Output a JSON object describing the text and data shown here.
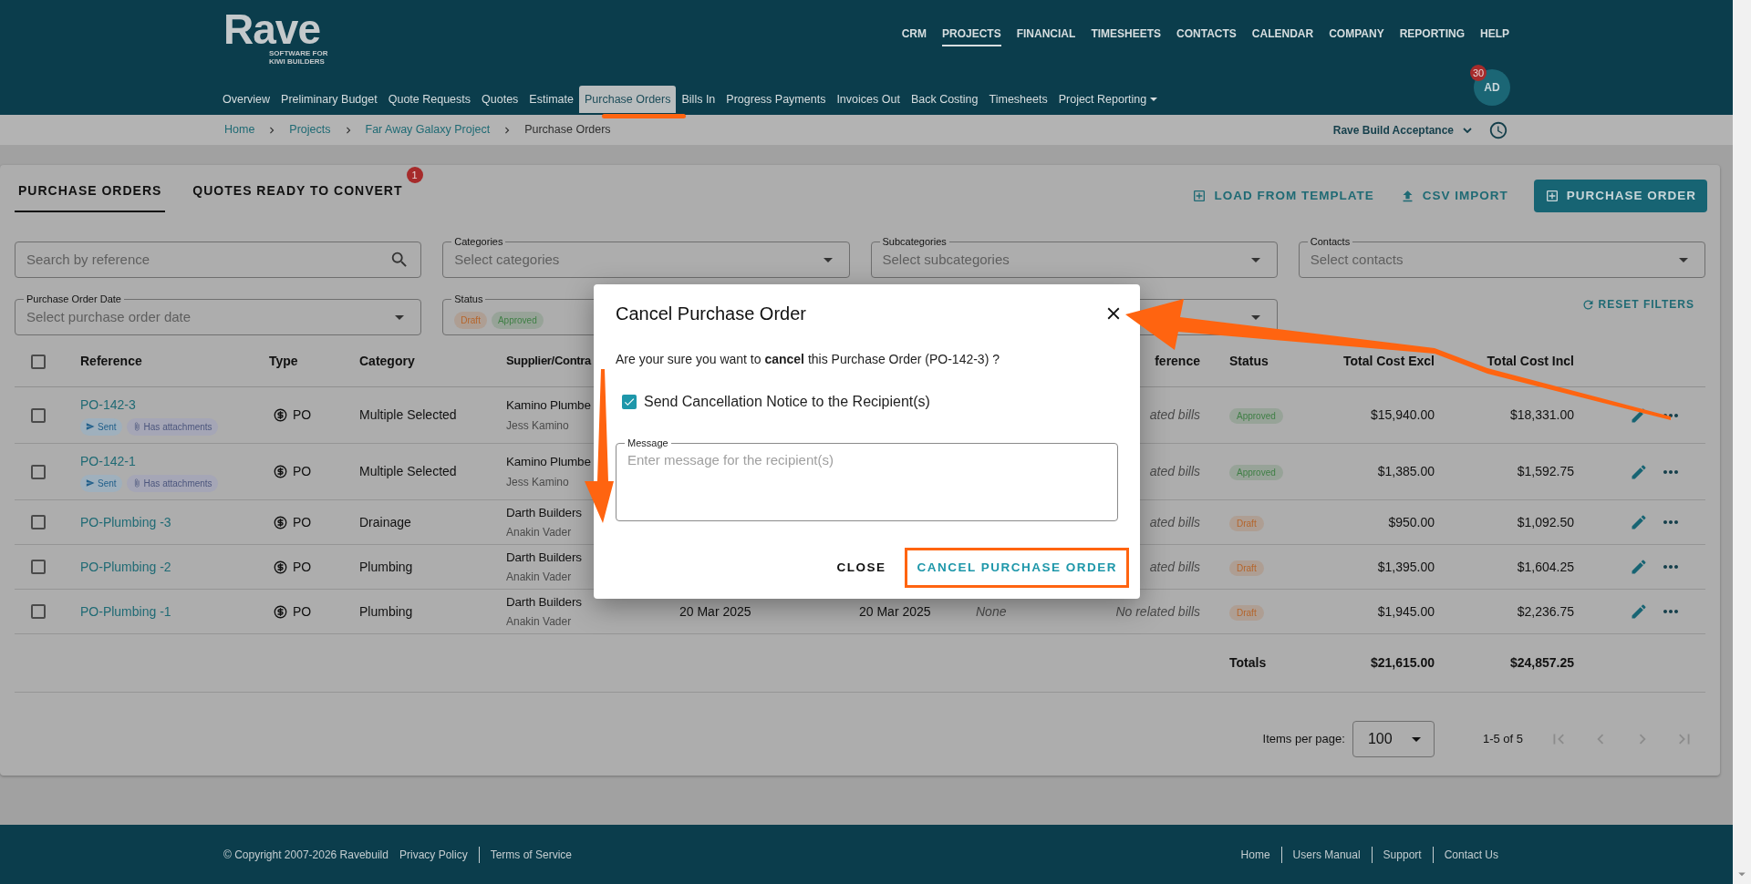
{
  "header": {
    "logo": {
      "name": "Rave",
      "tagline": [
        "SOFTWARE FOR",
        "KIWI BUILDERS"
      ]
    },
    "top_nav": [
      {
        "label": "CRM",
        "selected": false
      },
      {
        "label": "PROJECTS",
        "selected": true
      },
      {
        "label": "FINANCIAL",
        "selected": false
      },
      {
        "label": "TIMESHEETS",
        "selected": false
      },
      {
        "label": "CONTACTS",
        "selected": false
      },
      {
        "label": "CALENDAR",
        "selected": false
      },
      {
        "label": "COMPANY",
        "selected": false
      },
      {
        "label": "REPORTING",
        "selected": false
      },
      {
        "label": "HELP",
        "selected": false
      }
    ],
    "sub_nav": [
      {
        "label": "Overview",
        "selected": false,
        "dropdown": false
      },
      {
        "label": "Preliminary Budget",
        "selected": false,
        "dropdown": false
      },
      {
        "label": "Quote Requests",
        "selected": false,
        "dropdown": false
      },
      {
        "label": "Quotes",
        "selected": false,
        "dropdown": false
      },
      {
        "label": "Estimate",
        "selected": false,
        "dropdown": false
      },
      {
        "label": "Purchase Orders",
        "selected": true,
        "dropdown": false
      },
      {
        "label": "Bills In",
        "selected": false,
        "dropdown": false
      },
      {
        "label": "Progress Payments",
        "selected": false,
        "dropdown": false
      },
      {
        "label": "Invoices Out",
        "selected": false,
        "dropdown": false
      },
      {
        "label": "Back Costing",
        "selected": false,
        "dropdown": false
      },
      {
        "label": "Timesheets",
        "selected": false,
        "dropdown": false
      },
      {
        "label": "Project Reporting",
        "selected": false,
        "dropdown": true
      }
    ],
    "avatar": {
      "initials": "AD",
      "badge": "30"
    }
  },
  "breadcrumbs": [
    "Home",
    "Projects",
    "Far Away Galaxy Project",
    "Purchase Orders"
  ],
  "company_selector": "Rave Build Acceptance",
  "tabs": [
    {
      "label": "PURCHASE ORDERS",
      "selected": true
    },
    {
      "label": "QUOTES READY TO CONVERT",
      "selected": false,
      "badge": "1"
    }
  ],
  "actions": [
    {
      "label": "LOAD FROM TEMPLATE",
      "kind": "template"
    },
    {
      "label": "CSV IMPORT",
      "kind": "import"
    },
    {
      "label": "PURCHASE ORDER",
      "kind": "primary"
    }
  ],
  "filters": [
    {
      "kind": "search",
      "placeholder": "Search by reference"
    },
    {
      "kind": "select",
      "label": "Categories",
      "placeholder": "Select categories"
    },
    {
      "kind": "select",
      "label": "Subcategories",
      "placeholder": "Select subcategories"
    },
    {
      "kind": "select",
      "label": "Contacts",
      "placeholder": "Select contacts"
    },
    {
      "kind": "select",
      "label": "Purchase Order Date",
      "placeholder": "Select purchase order date"
    },
    {
      "kind": "chips",
      "label": "Status",
      "chips": [
        {
          "label": "Draft",
          "color": "#b5652b"
        },
        {
          "label": "Approved",
          "color": "#3f7f45"
        }
      ]
    },
    {
      "kind": "select"
    }
  ],
  "reset_filters": "RESET FILTERS",
  "table": {
    "select_all": {
      "checked": false
    },
    "columns": {
      "reference": "Reference",
      "type": "Type",
      "category": "Category",
      "column_4": "Supplier/Contra",
      "column_8": "ference",
      "status": "Status",
      "total_excl": "Total Cost Excl",
      "total_incl": "Total Cost Incl"
    },
    "rows": [
      {
        "selected": false,
        "reference": "PO-142-3",
        "tags": [
          {
            "label": "Sent",
            "kind": "sent"
          },
          {
            "label": "Has attachments",
            "kind": "attachments"
          }
        ],
        "type": "PO",
        "category": "Multiple Selected",
        "column_4": {
          "name": "Kamino Plumbe",
          "contact": "Jess Kamino"
        },
        "column_8": "ated bills",
        "status": {
          "label": "Approved",
          "color": "#3f7f45"
        },
        "total_excl": "$15,940.00",
        "total_incl": "$18,331.00"
      },
      {
        "selected": false,
        "reference": "PO-142-1",
        "tags": [
          {
            "label": "Sent",
            "kind": "sent"
          },
          {
            "label": "Has attachments",
            "kind": "attachments"
          }
        ],
        "type": "PO",
        "category": "Multiple Selected",
        "column_4": {
          "name": "Kamino Plumbe",
          "contact": "Jess Kamino"
        },
        "column_8": "ated bills",
        "status": {
          "label": "Approved",
          "color": "#3f7f45"
        },
        "total_excl": "$1,385.00",
        "total_incl": "$1,592.75"
      },
      {
        "selected": false,
        "reference": "PO-Plumbing -3",
        "type": "PO",
        "category": "Drainage",
        "column_4": {
          "name": "Darth Builders",
          "contact": "Anakin Vader"
        },
        "column_8": "ated bills",
        "status": {
          "label": "Draft",
          "color": "#b5652b"
        },
        "total_excl": "$950.00",
        "total_incl": "$1,092.50"
      },
      {
        "selected": false,
        "reference": "PO-Plumbing -2",
        "type": "PO",
        "category": "Plumbing",
        "column_4": {
          "name": "Darth Builders",
          "contact": "Anakin Vader"
        },
        "column_8": "ated bills",
        "status": {
          "label": "Draft",
          "color": "#b5652b"
        },
        "total_excl": "$1,395.00",
        "total_incl": "$1,604.25"
      },
      {
        "selected": false,
        "reference": "PO-Plumbing -1",
        "type": "PO",
        "category": "Plumbing",
        "column_4": {
          "name": "Darth Builders",
          "contact": "Anakin Vader"
        },
        "column_5": "20 Mar 2025",
        "column_6": "20 Mar 2025",
        "column_7": "None",
        "column_8": "No related bills",
        "status": {
          "label": "Draft",
          "color": "#b5652b"
        },
        "total_excl": "$1,945.00",
        "total_incl": "$2,236.75"
      }
    ],
    "totals": {
      "label": "Totals",
      "total_excl": "$21,615.00",
      "total_incl": "$24,857.25"
    }
  },
  "pagination": {
    "label": "Items per page:",
    "page_size": "100",
    "range": "1-5 of 5",
    "buttons": [
      {
        "kind": "first",
        "disabled": true
      },
      {
        "kind": "previous",
        "disabled": true
      },
      {
        "kind": "next",
        "disabled": true
      },
      {
        "kind": "last",
        "disabled": true
      }
    ]
  },
  "modal": {
    "title": "Cancel Purchase Order",
    "message": "Are your sure you want to **cancel** this Purchase Order (PO-142-3) ?",
    "notify": {
      "label": "Send Cancellation Notice to the Recipient(s)",
      "checked": true
    },
    "field": {
      "label": "Message",
      "placeholder": "Enter message for the recipient(s)"
    },
    "buttons": [
      {
        "label": "CLOSE",
        "kind": "text",
        "highlighted": false
      },
      {
        "label": "CANCEL PURCHASE ORDER",
        "kind": "confirm",
        "highlighted": true
      }
    ]
  },
  "footer": {
    "copyright": "© Copyright 2007-2026 Ravebuild",
    "left_links": [
      "Privacy Policy",
      "Terms of Service"
    ],
    "right_links": [
      "Home",
      "Users Manual",
      "Support",
      "Contact Us"
    ]
  }
}
